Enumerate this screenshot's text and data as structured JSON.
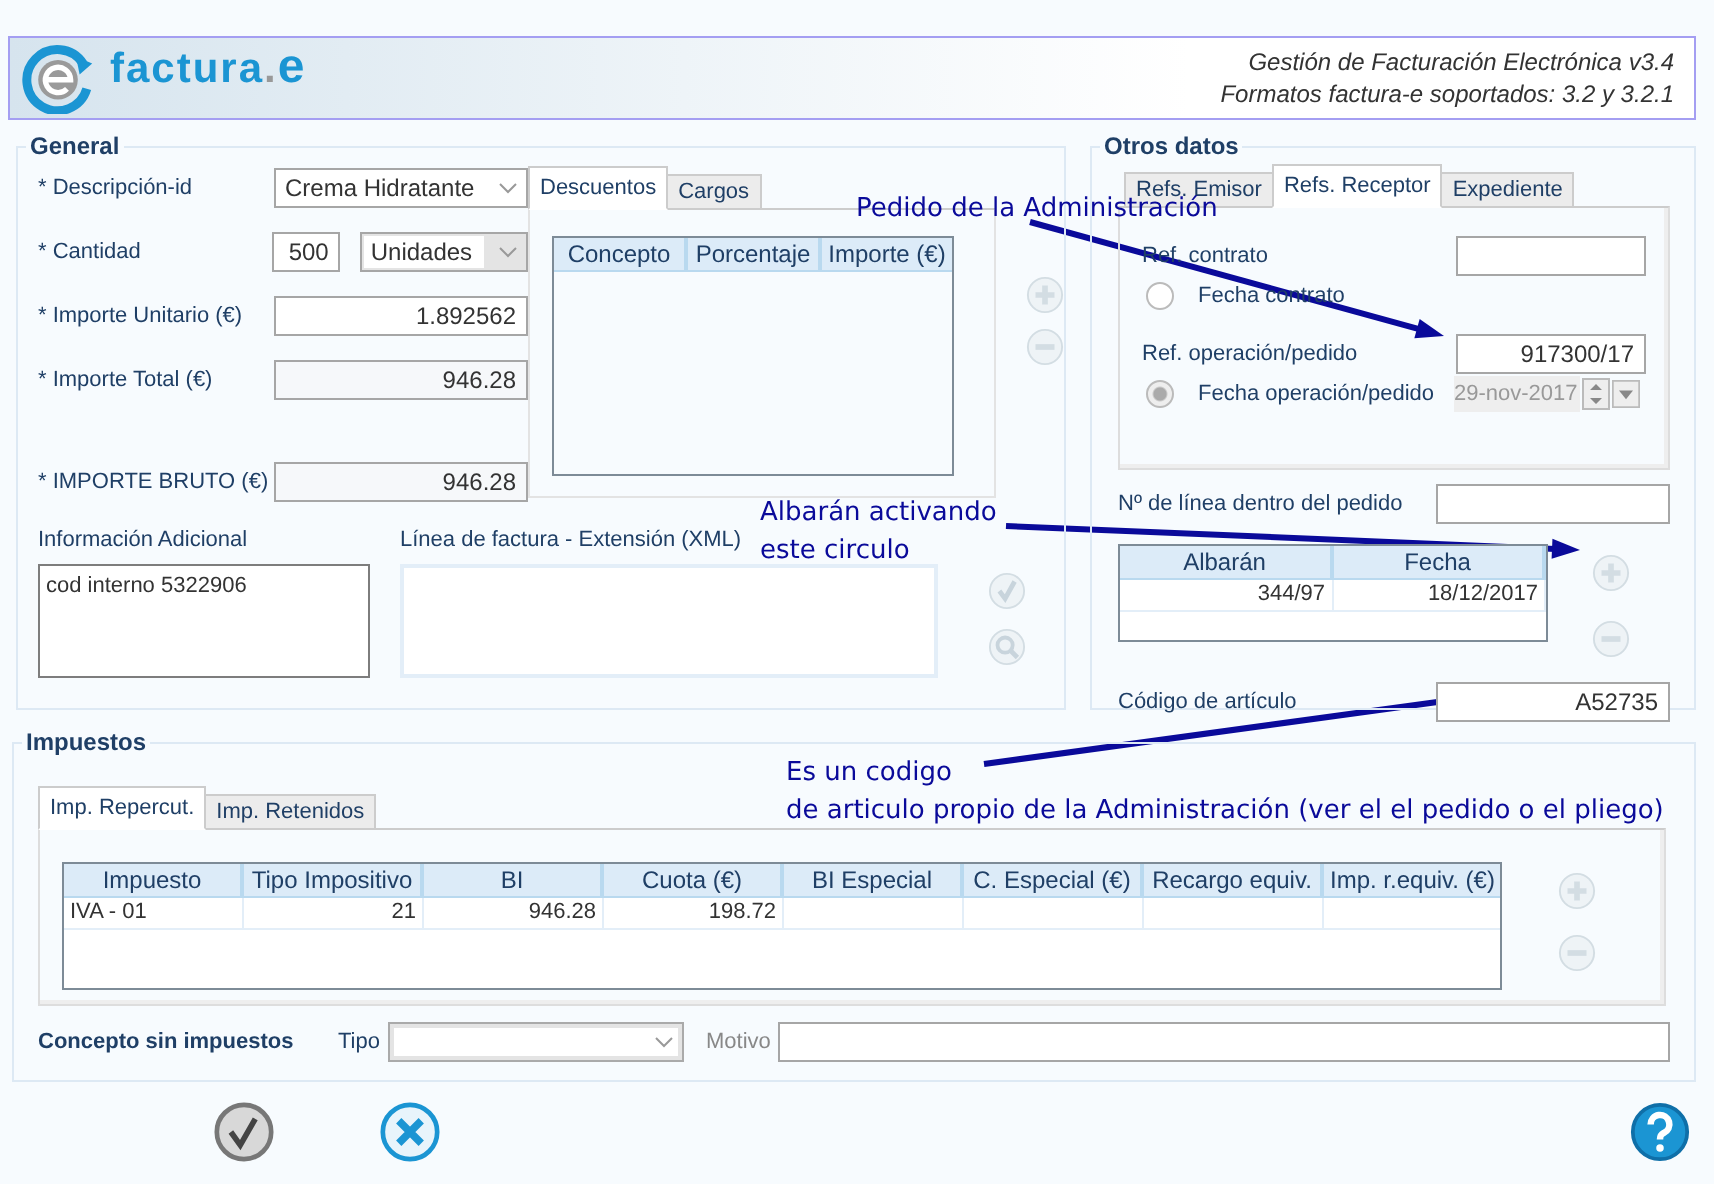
{
  "header": {
    "logo": {
      "word": "factura",
      "dot": ".",
      "letter": "e"
    },
    "lines": [
      "Gestión de Facturación Electrónica v3.4",
      "Formatos factura-e soportados: 3.2 y 3.2.1"
    ]
  },
  "general": {
    "title": "General",
    "fields": [
      {
        "label": "* Descripción-id",
        "kind": "select",
        "value": "Crema Hidratante"
      },
      {
        "label": "* Cantidad",
        "kind": "quantity",
        "value": "500",
        "unit": "Unidades"
      },
      {
        "label": "* Importe Unitario (€)",
        "kind": "input",
        "value": "1.892562"
      },
      {
        "label": "* Importe Total (€)",
        "kind": "readonly",
        "value": "946.28"
      },
      {
        "label": "* IMPORTE BRUTO (€)",
        "kind": "readonly",
        "value": "946.28"
      }
    ],
    "adjustments": {
      "tabs": [
        {
          "label": "Descuentos",
          "selected": true
        },
        {
          "label": "Cargos",
          "selected": false
        }
      ],
      "columns": [
        "Concepto",
        "Porcentaje",
        "Importe (€)"
      ]
    },
    "additional_info": {
      "label": "Información Adicional",
      "value": "cod interno 5322906"
    },
    "extension": {
      "label": "Línea de factura - Extensión (XML)"
    }
  },
  "other": {
    "title": "Otros datos",
    "tabs": [
      {
        "label": "Refs. Emisor",
        "selected": false
      },
      {
        "label": "Refs. Receptor",
        "selected": true
      },
      {
        "label": "Expediente",
        "selected": false
      }
    ],
    "ref_contrato": {
      "label": "Ref. contrato"
    },
    "fecha_contrato": {
      "label": "Fecha contrato",
      "selected": false
    },
    "ref_operacion": {
      "label": "Ref. operación/pedido",
      "value": "917300/17"
    },
    "fecha_operacion": {
      "label": "Fecha operación/pedido",
      "selected": true,
      "disabled": true,
      "value": "29-nov-2017"
    },
    "line_number": {
      "label": "Nº de línea dentro del pedido"
    },
    "delivery_notes": {
      "columns": [
        "Albarán",
        "Fecha"
      ],
      "rows": [
        [
          "344/97",
          "18/12/2017"
        ]
      ]
    },
    "article_code": {
      "label": "Código de artículo",
      "value": "A52735"
    }
  },
  "taxes": {
    "title": "Impuestos",
    "tabs": [
      {
        "label": "Imp. Repercut.",
        "selected": true
      },
      {
        "label": "Imp. Retenidos",
        "selected": false
      }
    ],
    "columns": [
      "Impuesto",
      "Tipo Impositivo",
      "BI",
      "Cuota (€)",
      "BI Especial",
      "C. Especial (€)",
      "Recargo equiv.",
      "Imp. r.equiv. (€)"
    ],
    "rows": [
      {
        "cells": [
          "IVA - 01",
          "21",
          "946.28",
          "198.72"
        ]
      }
    ],
    "no_tax": {
      "label": "Concepto sin impuestos",
      "type_label": "Tipo",
      "reason_label": "Motivo"
    }
  },
  "annotations": [
    {
      "lines": [
        "Pedido de la Administración"
      ]
    },
    {
      "lines": [
        "Albarán activando",
        "este circulo"
      ]
    },
    {
      "lines": [
        "Es un codigo",
        "de articulo propio de la Administración (ver el el pedido o el pliego)"
      ]
    }
  ]
}
